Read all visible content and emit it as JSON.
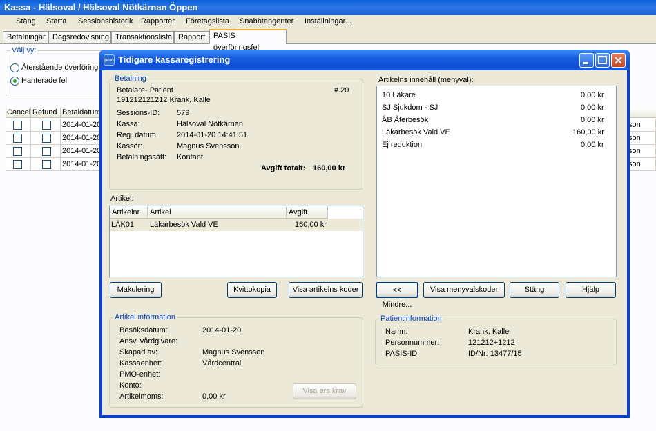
{
  "window": {
    "title": "Kassa - Hälsoval / Hälsoval Nötkärnan Öppen"
  },
  "menu": [
    "Stäng",
    "Starta",
    "Sessionshistorik",
    "Rapporter",
    "Företagslista",
    "Snabbtangenter",
    "Inställningar..."
  ],
  "tabs": [
    "Betalningar",
    "Dagsredovisning",
    "Transaktionslista",
    "Rapport",
    "PASIS överföringsfel"
  ],
  "view": {
    "legend": "Välj vy:",
    "option1": "Återstående överföring",
    "option2": "Hanterade fel"
  },
  "grid": {
    "headers": [
      "Cancel",
      "Refund",
      "Betaldatum"
    ],
    "rows": [
      {
        "date": "2014-01-20",
        "tail": "son"
      },
      {
        "date": "2014-01-20",
        "tail": "son"
      },
      {
        "date": "2014-01-20",
        "tail": "son"
      },
      {
        "date": "2014-01-20",
        "tail": "son"
      }
    ]
  },
  "dialog": {
    "title": "Tidigare kassaregistrering",
    "icon_text": "pmo",
    "payment": {
      "legend": "Betalning",
      "payer_type": "Betalare- Patient",
      "number": "# 20",
      "payer": "191212121212  Krank, Kalle",
      "session_label": "Sessions-ID:",
      "session_value": "579",
      "kassa_label": "Kassa:",
      "kassa_value": "Hälsoval Nötkärnan",
      "regdate_label": "Reg. datum:",
      "regdate_value": "2014-01-20 14:41:51",
      "cashier_label": "Kassör:",
      "cashier_value": "Magnus Svensson",
      "method_label": "Betalningssätt:",
      "method_value": "Kontant",
      "total_label": "Avgift totalt:",
      "total_value": "160,00 kr"
    },
    "article_list": {
      "label": "Artikel:",
      "headers": [
        "Artikelnr",
        "Artikel",
        "Avgift"
      ],
      "rows": [
        {
          "nr": "LÄK01",
          "name": "Läkarbesök Vald VE",
          "fee": "160,00 kr"
        }
      ]
    },
    "contents": {
      "label": "Artikelns innehåll (menyval):",
      "items": [
        {
          "name": "10 Läkare",
          "value": "0,00 kr"
        },
        {
          "name": "SJ Sjukdom - SJ",
          "value": "0,00 kr"
        },
        {
          "name": "ÅB Återbesök",
          "value": "0,00 kr"
        },
        {
          "name": "Läkarbesök Vald VE",
          "value": "160,00 kr"
        },
        {
          "name": "Ej reduktion",
          "value": "0,00 kr"
        }
      ]
    },
    "buttons": {
      "makulering": "Makulering",
      "kvittokopia": "Kvittokopia",
      "visa_artikel": "Visa artikelns koder",
      "mindre": "<< Mindre...",
      "visa_meny": "Visa menyvalskoder",
      "stang": "Stäng",
      "hjalp": "Hjälp",
      "visa_ers": "Visa ers krav"
    },
    "article_info": {
      "legend": "Artikel information",
      "rows": [
        {
          "label": "Besöksdatum:",
          "value": "2014-01-20"
        },
        {
          "label": "Ansv. vårdgivare:",
          "value": ""
        },
        {
          "label": "Skapad av:",
          "value": "Magnus Svensson"
        },
        {
          "label": "Kassaenhet:",
          "value": "Vårdcentral"
        },
        {
          "label": "PMO-enhet:",
          "value": ""
        },
        {
          "label": "Konto:",
          "value": ""
        },
        {
          "label": "Artikelmoms:",
          "value": "0,00 kr"
        }
      ]
    },
    "patient_info": {
      "legend": "Patientinformation",
      "rows": [
        {
          "label": "Namn:",
          "value": "Krank, Kalle"
        },
        {
          "label": "Personnummer:",
          "value": "121212+1212"
        },
        {
          "label": "PASIS-ID",
          "value": "ID/Nr: 13477/15"
        }
      ]
    }
  }
}
